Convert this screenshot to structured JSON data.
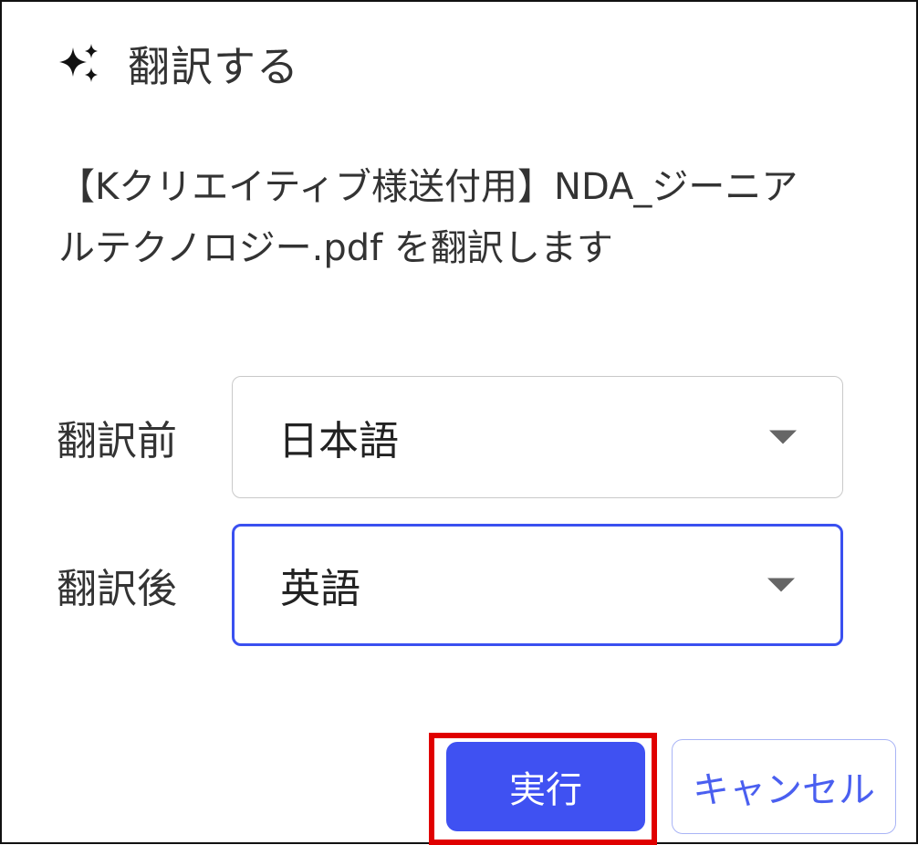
{
  "dialog": {
    "title": "翻訳する",
    "icon": "sparkle-icon",
    "message": "【Kクリエイティブ様送付用】NDA_ジーニアルテクノロジー.pdf を翻訳します"
  },
  "source_language": {
    "label": "翻訳前",
    "value": "日本語"
  },
  "target_language": {
    "label": "翻訳後",
    "value": "英語"
  },
  "buttons": {
    "execute": "実行",
    "cancel": "キャンセル"
  },
  "colors": {
    "primary": "#3f51f2",
    "focus_border": "#3a50f0",
    "highlight": "#e00000"
  }
}
